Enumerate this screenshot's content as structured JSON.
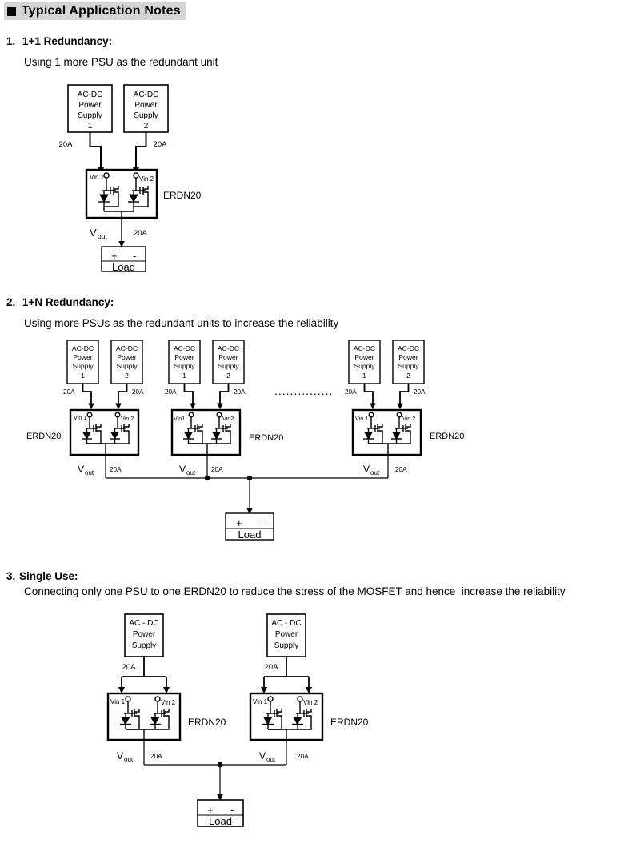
{
  "header": {
    "title": "Typical Application Notes",
    "bullet_icon": "filled-square-icon"
  },
  "sections": [
    {
      "number": "1.",
      "title": "1+1 Redundancy:",
      "description": "Using 1 more PSU as the redundant unit"
    },
    {
      "number": "2.",
      "title": "1+N Redundancy:",
      "description": "Using more PSUs as the redundant units to increase the reliability"
    },
    {
      "number": "3.",
      "title": "Single Use:",
      "description": "Connecting only one PSU to one ERDN20 to reduce the stress of the MOSFET and hence  increase the reliability"
    }
  ],
  "labels": {
    "psu_line1": "AC-DC",
    "psu_line1_spaced": "AC - DC",
    "psu_line2": "Power",
    "psu_line3": "Supply",
    "psu_num_1": "1",
    "psu_num_2": "2",
    "current": "20A",
    "vin1": "Vin 1",
    "vin2": "Vin 2",
    "vin1_tight": "Vin1",
    "vin2_tight": "Vin2",
    "device": "ERDN20",
    "vout_main": "V",
    "vout_sub": "out",
    "load": "Load",
    "plus": "+",
    "minus": "-",
    "ellipsis": "..............."
  },
  "colors": {
    "header_bg": "#d5d5d5",
    "line": "#000000",
    "page_bg": "#ffffff"
  },
  "diagram1": {
    "psus": [
      {
        "label_num": "1",
        "current": "20A"
      },
      {
        "label_num": "2",
        "current": "20A"
      }
    ],
    "device_label": "ERDN20",
    "output_current": "20A"
  },
  "diagram2": {
    "groups": [
      {
        "device_label": "ERDN20",
        "label_side": "left",
        "vin1": "Vin 1",
        "vin2": "Vin 2",
        "psu_currents": [
          "20A",
          "20A"
        ],
        "output_current": "20A"
      },
      {
        "device_label": "ERDN20",
        "label_side": "right",
        "vin1": "Vin1",
        "vin2": "Vin2",
        "psu_currents": [
          "20A",
          "20A"
        ],
        "output_current": "20A"
      },
      {
        "device_label": "ERDN20",
        "label_side": "right",
        "vin1": "Vin 1",
        "vin2": "Vin 2",
        "psu_currents": [
          "20A",
          "20A"
        ],
        "output_current": "20A"
      }
    ],
    "ellipsis": "..............."
  },
  "diagram3": {
    "groups": [
      {
        "device_label": "ERDN20",
        "psu_current": "20A",
        "output_current": "20A"
      },
      {
        "device_label": "ERDN20",
        "psu_current": "20A",
        "output_current": "20A"
      }
    ]
  }
}
